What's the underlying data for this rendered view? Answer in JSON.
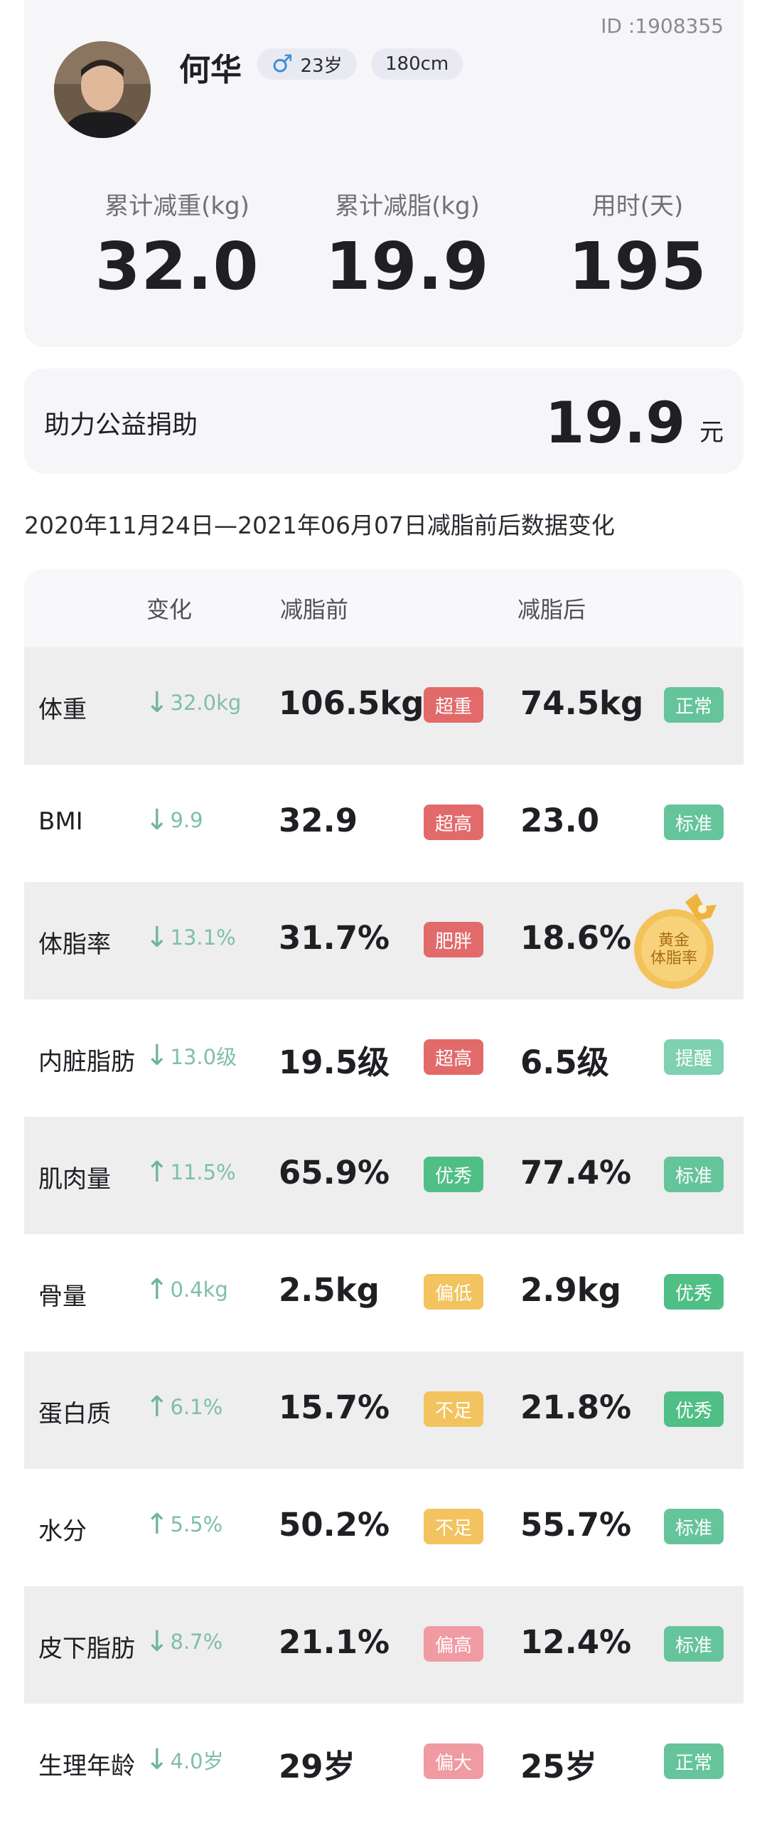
{
  "profile": {
    "user_id": "ID :1908355",
    "name": "何华",
    "age": "23岁",
    "height": "180cm",
    "stats": [
      {
        "label": "累计减重(kg)",
        "value": "32.0"
      },
      {
        "label": "累计减脂(kg)",
        "value": "19.9"
      },
      {
        "label": "用时(天)",
        "value": "195"
      }
    ]
  },
  "donation": {
    "label": "助力公益捐助",
    "amount": "19.9",
    "unit": "元"
  },
  "date_range": "2020年11月24日—2021年06月07日减脂前后数据变化",
  "table": {
    "headers": {
      "change": "变化",
      "before": "减脂前",
      "after": "减脂后"
    },
    "rows": [
      {
        "name": "体重",
        "change": "32.0kg",
        "direction": "down",
        "before": "106.5kg",
        "before_badge": "超重",
        "after": "74.5kg",
        "after_badge": "正常"
      },
      {
        "name": "BMI",
        "change": "9.9",
        "direction": "down",
        "before": "32.9",
        "before_badge": "超高",
        "after": "23.0",
        "after_badge": "标准"
      },
      {
        "name": "体脂率",
        "change": "13.1%",
        "direction": "down",
        "before": "31.7%",
        "before_badge": "肥胖",
        "after": "18.6%",
        "after_badge": "",
        "medal": "黄金\n体脂率"
      },
      {
        "name": "内脏脂肪",
        "change": "13.0级",
        "direction": "down",
        "before": "19.5级",
        "before_badge": "超高",
        "after": "6.5级",
        "after_badge": "提醒"
      },
      {
        "name": "肌肉量",
        "change": "11.5%",
        "direction": "up",
        "before": "65.9%",
        "before_badge": "优秀",
        "after": "77.4%",
        "after_badge": "标准"
      },
      {
        "name": "骨量",
        "change": "0.4kg",
        "direction": "up",
        "before": "2.5kg",
        "before_badge": "偏低",
        "after": "2.9kg",
        "after_badge": "优秀"
      },
      {
        "name": "蛋白质",
        "change": "6.1%",
        "direction": "up",
        "before": "15.7%",
        "before_badge": "不足",
        "after": "21.8%",
        "after_badge": "优秀"
      },
      {
        "name": "水分",
        "change": "5.5%",
        "direction": "up",
        "before": "50.2%",
        "before_badge": "不足",
        "after": "55.7%",
        "after_badge": "标准"
      },
      {
        "name": "皮下脂肪",
        "change": "8.7%",
        "direction": "down",
        "before": "21.1%",
        "before_badge": "偏高",
        "after": "12.4%",
        "after_badge": "标准"
      },
      {
        "name": "生理年龄",
        "change": "4.0岁",
        "direction": "down",
        "before": "29岁",
        "before_badge": "偏大",
        "after": "25岁",
        "after_badge": "正常"
      }
    ]
  },
  "badge_colors": {
    "超重": "#e26a6a",
    "超高": "#e26a6a",
    "肥胖": "#e26a6a",
    "偏高": "#f09aa2",
    "偏大": "#f09aa2",
    "偏低": "#f2c35e",
    "不足": "#f2c35e",
    "优秀": "#4fbf86",
    "正常": "#66c49b",
    "标准": "#66c49b",
    "提醒": "#7fd1b1"
  },
  "icons": {
    "gender": "male-icon",
    "down": "arrow-down-icon",
    "up": "arrow-up-icon",
    "medal": "gold-medal-icon"
  }
}
